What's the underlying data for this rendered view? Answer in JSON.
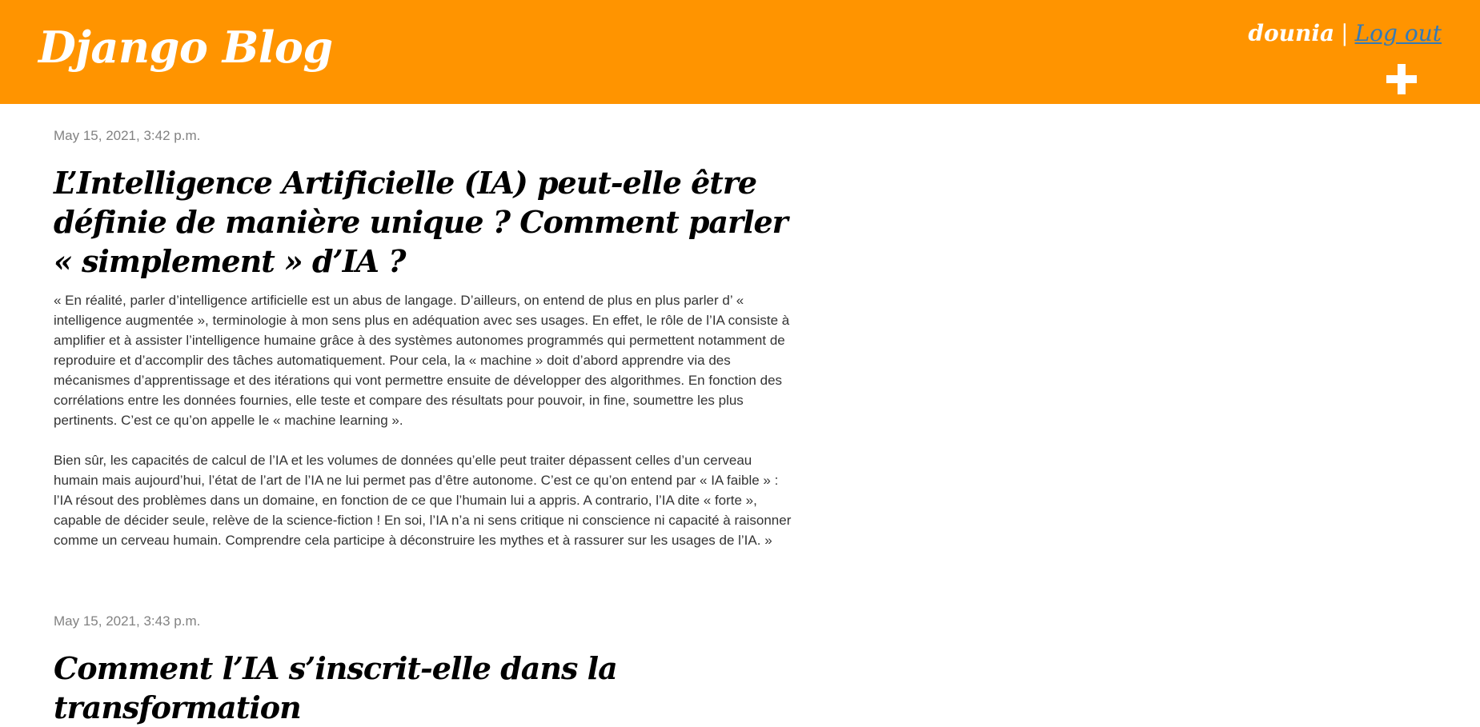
{
  "header": {
    "site_title": "Django Blog",
    "username": "dounia",
    "separator": "|",
    "logout_label": "Log out",
    "add_icon": "plus-icon",
    "background_color": "#ff9400"
  },
  "posts": [
    {
      "date": "May 15, 2021, 3:42 p.m.",
      "title": "L’Intelligence Artificielle (IA) peut-elle être définie de manière unique ? Comment parler « simplement » d’IA ?",
      "paragraphs": [
        "« En réalité, parler d’intelligence artificielle est un abus de langage. D’ailleurs, on entend de plus en plus parler d’ « intelligence augmentée », terminologie à mon sens plus en adéquation avec ses usages. En effet, le rôle de l’IA consiste à amplifier et à assister l’intelligence humaine grâce à des systèmes autonomes programmés qui permettent notamment de reproduire et d’accomplir des tâches automatiquement. Pour cela, la « machine » doit d’abord apprendre via des mécanismes d’apprentissage et des itérations qui vont permettre ensuite de développer des algorithmes. En fonction des corrélations entre les données fournies, elle teste et compare des résultats pour pouvoir, in fine, soumettre les plus pertinents. C’est ce qu’on appelle le « machine learning ».",
        "Bien sûr, les capacités de calcul de l’IA et les volumes de données qu’elle peut traiter dépassent celles d’un cerveau humain mais aujourd’hui, l’état de l’art de l’IA ne lui permet pas d’être autonome. C’est ce qu’on entend par « IA faible » : l’IA résout des problèmes dans un domaine, en fonction de ce que l’humain lui a appris. A contrario, l’IA dite « forte », capable de décider seule, relève de la science-fiction ! En soi, l’IA n’a ni sens critique ni conscience ni capacité à raisonner comme un cerveau humain. Comprendre cela participe à déconstruire les mythes et à rassurer sur les usages de l’IA.  »"
      ]
    },
    {
      "date": "May 15, 2021, 3:43 p.m.",
      "title": "Comment l’IA s’inscrit-elle dans la transformation"
    }
  ]
}
